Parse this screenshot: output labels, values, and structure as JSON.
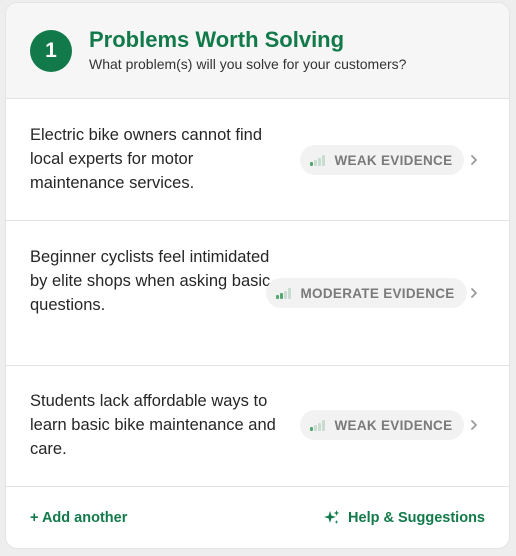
{
  "header": {
    "step_number": "1",
    "title": "Problems Worth Solving",
    "subtitle": "What problem(s) will you solve for your customers?"
  },
  "problems": [
    {
      "text": "Electric bike owners cannot find local experts for motor maintenance services.",
      "evidence_label": "WEAK EVIDENCE",
      "evidence_level": 1,
      "evidence_max": 4,
      "icon": "signal-bars-icon"
    },
    {
      "text": "Beginner cyclists feel intimidated by elite shops when asking basic questions.",
      "evidence_label": "MODERATE EVIDENCE",
      "evidence_level": 2,
      "evidence_max": 4,
      "icon": "signal-bars-icon"
    },
    {
      "text": "Students lack affordable ways to learn basic bike maintenance and care.",
      "evidence_label": "WEAK EVIDENCE",
      "evidence_level": 1,
      "evidence_max": 4,
      "icon": "signal-bars-icon"
    }
  ],
  "footer": {
    "add_label": "+ Add another",
    "help_label": "Help & Suggestions",
    "help_icon": "sparkle-icon"
  },
  "colors": {
    "brand_green": "#127a4a",
    "evidence_bar_on": "#52a870",
    "evidence_bar_off": "#c8dcd0",
    "pill_background": "#f2f2f2"
  }
}
